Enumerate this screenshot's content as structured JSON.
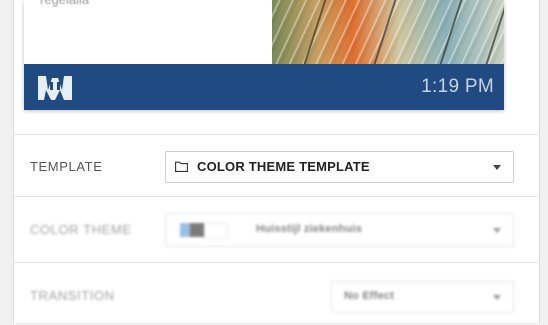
{
  "preview": {
    "caption": "regelalla",
    "time": "1:19 PM"
  },
  "template": {
    "label": "TEMPLATE",
    "value": "COLOR THEME TEMPLATE"
  },
  "color_theme": {
    "label": "COLOR THEME",
    "value": "Huisstijl ziekenhuis"
  },
  "transition": {
    "label": "TRANSITION",
    "value": "No Effect"
  },
  "colors": {
    "brand_bar": "#1f4a82",
    "page_bg": "#f0f0f0"
  },
  "icons": {
    "logo": "brand-logo-icon",
    "folder": "folder-icon",
    "dropdown": "chevron-down-icon"
  }
}
